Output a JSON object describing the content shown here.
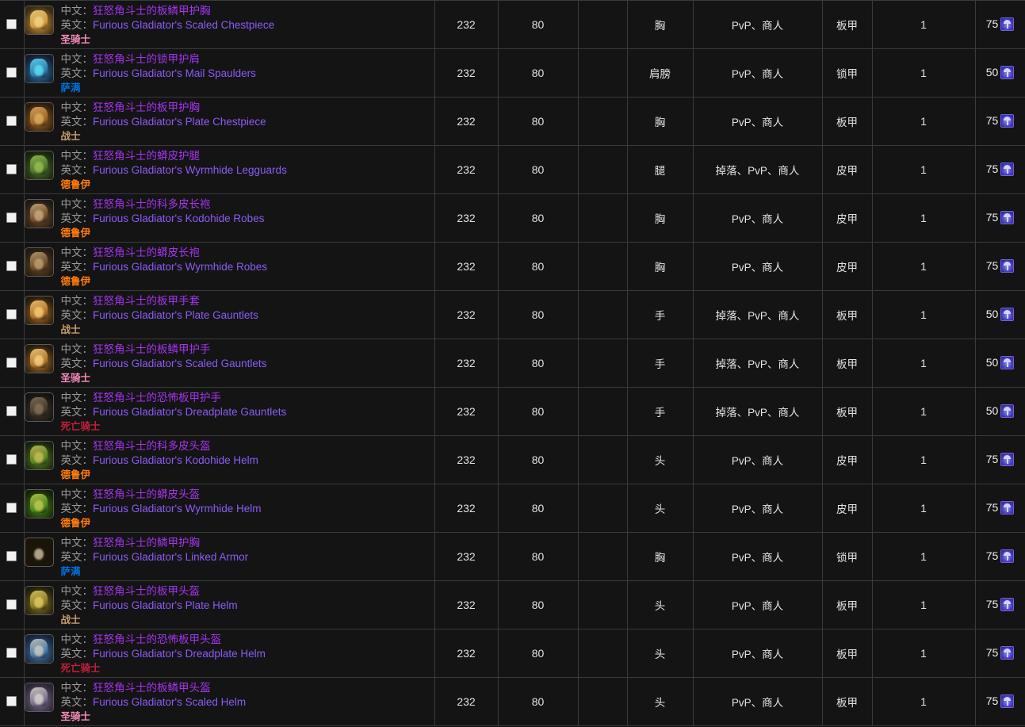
{
  "table": {
    "labels": {
      "zh_prefix": "中文：",
      "en_prefix": "英文："
    },
    "class_colors": {
      "圣骑士": "#F58CBA",
      "萨满": "#0070DE",
      "战士": "#C79C6E",
      "德鲁伊": "#FF7D0A",
      "死亡骑士": "#C41F3B"
    },
    "rows": [
      {
        "checkbox": "unchecked",
        "zh_name": "狂怒角斗士的板鳞甲护胸",
        "en_name": "Furious Gladiator's Scaled Chestpiece",
        "class": "圣骑士",
        "item_level": "232",
        "req_level": "80",
        "blank": "",
        "slot": "胸",
        "source": "PvP、商人",
        "armor_type": "板甲",
        "count": "1",
        "cost": "75",
        "cost_icon": "arena-point-icon",
        "icon_colors": [
          "#3a2a12",
          "#d8a03c",
          "#f5d98a"
        ]
      },
      {
        "checkbox": "unchecked",
        "zh_name": "狂怒角斗士的锁甲护肩",
        "en_name": "Furious Gladiator's Mail Spaulders",
        "class": "萨满",
        "item_level": "232",
        "req_level": "80",
        "blank": "",
        "slot": "肩膀",
        "source": "PvP、商人",
        "armor_type": "锁甲",
        "count": "1",
        "cost": "50",
        "cost_icon": "arena-point-icon",
        "icon_colors": [
          "#121c30",
          "#2f7fb0",
          "#5fe8ff"
        ]
      },
      {
        "checkbox": "unchecked",
        "zh_name": "狂怒角斗士的板甲护胸",
        "en_name": "Furious Gladiator's Plate Chestpiece",
        "class": "战士",
        "item_level": "232",
        "req_level": "80",
        "blank": "",
        "slot": "胸",
        "source": "PvP、商人",
        "armor_type": "板甲",
        "count": "1",
        "cost": "75",
        "cost_icon": "arena-point-icon",
        "icon_colors": [
          "#2b1b0c",
          "#a36a28",
          "#e3b263"
        ]
      },
      {
        "checkbox": "unchecked",
        "zh_name": "狂怒角斗士的蟒皮护腿",
        "en_name": "Furious Gladiator's Wyrmhide Legguards",
        "class": "德鲁伊",
        "item_level": "232",
        "req_level": "80",
        "blank": "",
        "slot": "腿",
        "source": "掉落、PvP、商人",
        "armor_type": "皮甲",
        "count": "1",
        "cost": "75",
        "cost_icon": "arena-point-icon",
        "icon_colors": [
          "#17220e",
          "#4f7a2a",
          "#9ec455"
        ]
      },
      {
        "checkbox": "unchecked",
        "zh_name": "狂怒角斗士的科多皮长袍",
        "en_name": "Furious Gladiator's Kodohide Robes",
        "class": "德鲁伊",
        "item_level": "232",
        "req_level": "80",
        "blank": "",
        "slot": "胸",
        "source": "PvP、商人",
        "armor_type": "皮甲",
        "count": "1",
        "cost": "75",
        "cost_icon": "arena-point-icon",
        "icon_colors": [
          "#1d1a14",
          "#7a4f28",
          "#cdb386"
        ]
      },
      {
        "checkbox": "unchecked",
        "zh_name": "狂怒角斗士的蟒皮长袍",
        "en_name": "Furious Gladiator's Wyrmhide Robes",
        "class": "德鲁伊",
        "item_level": "232",
        "req_level": "80",
        "blank": "",
        "slot": "胸",
        "source": "PvP、商人",
        "armor_type": "皮甲",
        "count": "1",
        "cost": "75",
        "cost_icon": "arena-point-icon",
        "icon_colors": [
          "#201a12",
          "#6d4b26",
          "#c3a878"
        ]
      },
      {
        "checkbox": "unchecked",
        "zh_name": "狂怒角斗士的板甲手套",
        "en_name": "Furious Gladiator's Plate Gauntlets",
        "class": "战士",
        "item_level": "232",
        "req_level": "80",
        "blank": "",
        "slot": "手",
        "source": "掉落、PvP、商人",
        "armor_type": "板甲",
        "count": "1",
        "cost": "50",
        "cost_icon": "arena-point-icon",
        "icon_colors": [
          "#251a0c",
          "#b5742a",
          "#ffd37a"
        ]
      },
      {
        "checkbox": "unchecked",
        "zh_name": "狂怒角斗士的板鳞甲护手",
        "en_name": "Furious Gladiator's Scaled Gauntlets",
        "class": "圣骑士",
        "item_level": "232",
        "req_level": "80",
        "blank": "",
        "slot": "手",
        "source": "掉落、PvP、商人",
        "armor_type": "板甲",
        "count": "1",
        "cost": "50",
        "cost_icon": "arena-point-icon",
        "icon_colors": [
          "#261a0d",
          "#b87a2d",
          "#ffd887"
        ]
      },
      {
        "checkbox": "unchecked",
        "zh_name": "狂怒角斗士的恐怖板甲护手",
        "en_name": "Furious Gladiator's Dreadplate Gauntlets",
        "class": "死亡骑士",
        "item_level": "232",
        "req_level": "80",
        "blank": "",
        "slot": "手",
        "source": "掉落、PvP、商人",
        "armor_type": "板甲",
        "count": "1",
        "cost": "50",
        "cost_icon": "arena-point-icon",
        "icon_colors": [
          "#141210",
          "#463a2a",
          "#8a775c"
        ]
      },
      {
        "checkbox": "unchecked",
        "zh_name": "狂怒角斗士的科多皮头盔",
        "en_name": "Furious Gladiator's Kodohide Helm",
        "class": "德鲁伊",
        "item_level": "232",
        "req_level": "80",
        "blank": "",
        "slot": "头",
        "source": "PvP、商人",
        "armor_type": "皮甲",
        "count": "1",
        "cost": "75",
        "cost_icon": "arena-point-icon",
        "icon_colors": [
          "#16210e",
          "#5f8a24",
          "#d2c25a"
        ]
      },
      {
        "checkbox": "unchecked",
        "zh_name": "狂怒角斗士的蟒皮头盔",
        "en_name": "Furious Gladiator's Wyrmhide Helm",
        "class": "德鲁伊",
        "item_level": "232",
        "req_level": "80",
        "blank": "",
        "slot": "头",
        "source": "PvP、商人",
        "armor_type": "皮甲",
        "count": "1",
        "cost": "75",
        "cost_icon": "arena-point-icon",
        "icon_colors": [
          "#152409",
          "#4e8d1d",
          "#c9cf52"
        ]
      },
      {
        "checkbox": "unchecked",
        "zh_name": "狂怒角斗士的鳞甲护胸",
        "en_name": "Furious Gladiator's Linked Armor",
        "class": "萨满",
        "item_level": "232",
        "req_level": "80",
        "blank": "",
        "slot": "胸",
        "source": "PvP、商人",
        "armor_type": "锁甲",
        "count": "1",
        "cost": "75",
        "cost_icon": "arena-point-icon",
        "icon_colors": [
          "#201a12",
          "#93apple",
          "#ddd0b0"
        ]
      },
      {
        "checkbox": "unchecked",
        "zh_name": "狂怒角斗士的板甲头盔",
        "en_name": "Furious Gladiator's Plate Helm",
        "class": "战士",
        "item_level": "232",
        "req_level": "80",
        "blank": "",
        "slot": "头",
        "source": "PvP、商人",
        "armor_type": "板甲",
        "count": "1",
        "cost": "75",
        "cost_icon": "arena-point-icon",
        "icon_colors": [
          "#1f1c0c",
          "#8e7b22",
          "#e6d36a"
        ]
      },
      {
        "checkbox": "unchecked",
        "zh_name": "狂怒角斗士的恐怖板甲头盔",
        "en_name": "Furious Gladiator's Dreadplate Helm",
        "class": "死亡骑士",
        "item_level": "232",
        "req_level": "80",
        "blank": "",
        "slot": "头",
        "source": "PvP、商人",
        "armor_type": "板甲",
        "count": "1",
        "cost": "75",
        "cost_icon": "arena-point-icon",
        "icon_colors": [
          "#16243a",
          "#4a7fae",
          "#d7d2c2"
        ]
      },
      {
        "checkbox": "unchecked",
        "zh_name": "狂怒角斗士的板鳞甲头盔",
        "en_name": "Furious Gladiator's Scaled Helm",
        "class": "圣骑士",
        "item_level": "232",
        "req_level": "80",
        "blank": "",
        "slot": "头",
        "source": "PvP、商人",
        "armor_type": "板甲",
        "count": "1",
        "cost": "75",
        "cost_icon": "arena-point-icon",
        "icon_colors": [
          "#2a2434",
          "#7e7490",
          "#e0dcd0"
        ]
      }
    ]
  }
}
